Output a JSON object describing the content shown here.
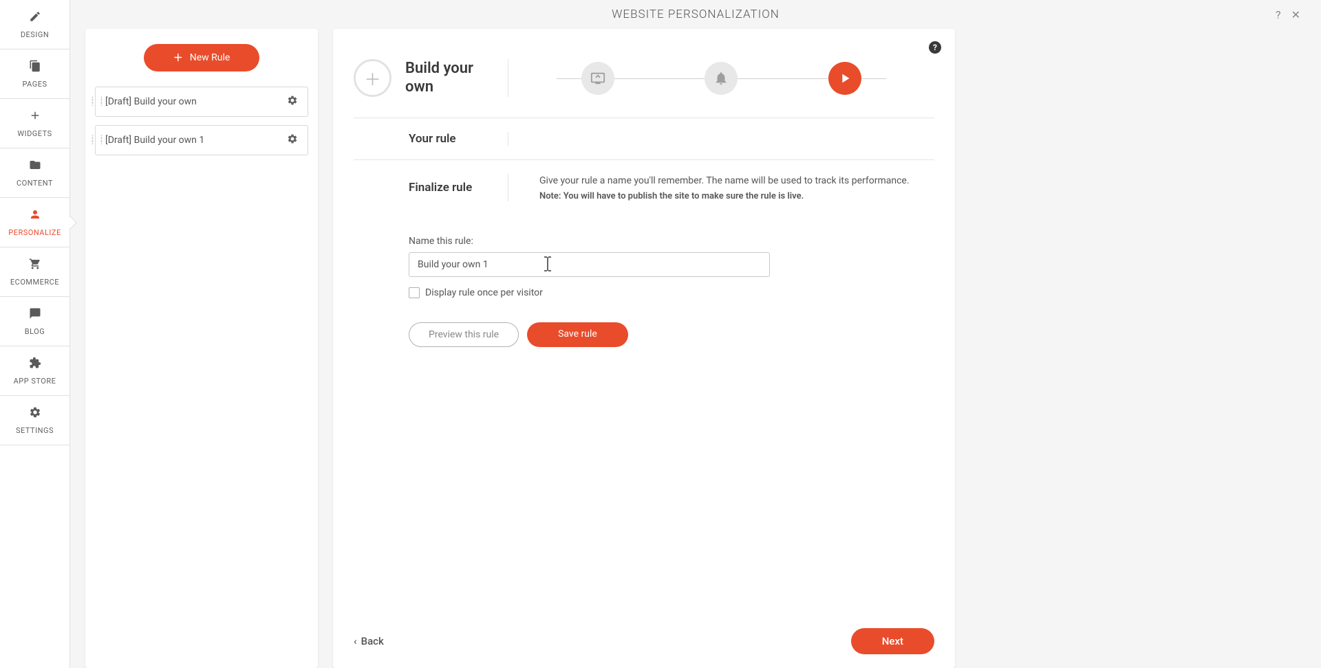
{
  "header": {
    "title": "WEBSITE PERSONALIZATION"
  },
  "sidebar": {
    "items": [
      {
        "label": "DESIGN"
      },
      {
        "label": "PAGES"
      },
      {
        "label": "WIDGETS"
      },
      {
        "label": "CONTENT"
      },
      {
        "label": "PERSONALIZE"
      },
      {
        "label": "ECOMMERCE"
      },
      {
        "label": "BLOG"
      },
      {
        "label": "APP STORE"
      },
      {
        "label": "SETTINGS"
      }
    ],
    "active_index": 4
  },
  "rules_panel": {
    "new_rule_label": "New Rule",
    "rules": [
      {
        "label": "[Draft] Build your own"
      },
      {
        "label": "[Draft] Build your own 1"
      }
    ]
  },
  "wizard": {
    "title": "Build your own",
    "active_step": 2
  },
  "sections": {
    "your_rule": {
      "label": "Your rule"
    },
    "finalize": {
      "label": "Finalize rule",
      "desc": "Give your rule a name you'll remember. The name will be used to track its performance.",
      "note": "Note: You will have to publish the site to make sure the rule is live."
    }
  },
  "form": {
    "name_label": "Name this rule:",
    "name_value": "Build your own 1",
    "checkbox_label": "Display rule once per visitor",
    "preview_btn": "Preview this rule",
    "save_btn": "Save rule"
  },
  "footer": {
    "back_label": "Back",
    "next_label": "Next"
  }
}
